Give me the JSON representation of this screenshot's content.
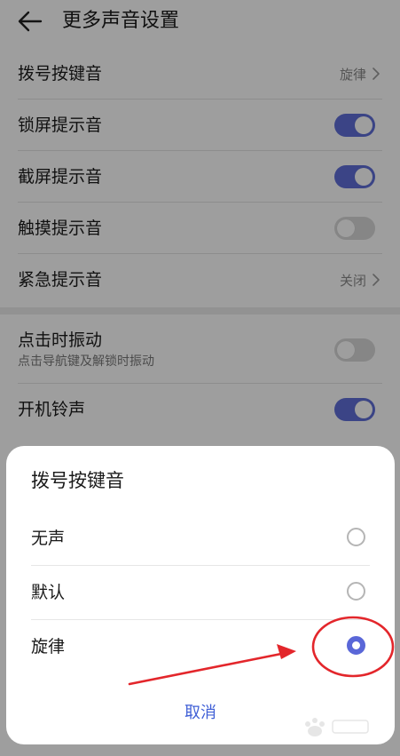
{
  "header": {
    "title": "更多声音设置"
  },
  "settings": [
    {
      "label": "拨号按键音",
      "control": "link",
      "value": "旋律"
    },
    {
      "label": "锁屏提示音",
      "control": "toggle",
      "on": true
    },
    {
      "label": "截屏提示音",
      "control": "toggle",
      "on": true
    },
    {
      "label": "触摸提示音",
      "control": "toggle",
      "on": false
    },
    {
      "label": "紧急提示音",
      "control": "link",
      "value": "关闭"
    },
    {
      "label": "点击时振动",
      "sublabel": "点击导航键及解锁时振动",
      "control": "toggle",
      "on": false
    },
    {
      "label": "开机铃声",
      "control": "toggle",
      "on": true
    }
  ],
  "dialog": {
    "title": "拨号按键音",
    "options": [
      {
        "label": "无声",
        "selected": false
      },
      {
        "label": "默认",
        "selected": false
      },
      {
        "label": "旋律",
        "selected": true
      }
    ],
    "cancel_label": "取消"
  },
  "colors": {
    "accent": "#5f6fd8",
    "cancel": "#3f5fd6",
    "annotation": "#e3262b"
  },
  "icons": {
    "back": "back-arrow-icon",
    "chevron": "chevron-right-icon",
    "watermark": "baidu-jingyan-watermark"
  }
}
